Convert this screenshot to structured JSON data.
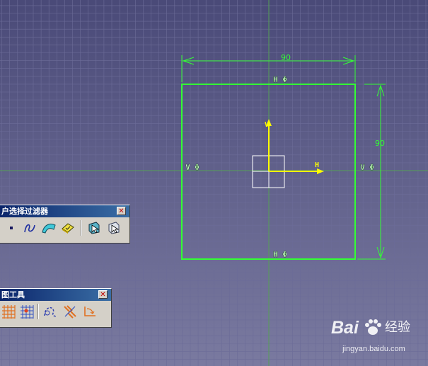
{
  "viewport": {
    "background_top": "#4a4a78",
    "background_bottom": "#7a7aa0",
    "grid_color": "#6c6c98",
    "axis_color": "#55a055"
  },
  "sketch": {
    "square_color": "#33ff33",
    "dim_color": "#33ff33",
    "axis_color": "#ffff00",
    "width_dim": "90",
    "height_dim": "90",
    "h_label": "H",
    "v_label": "V",
    "axis_h_label": "H",
    "axis_v_label": "V",
    "phi_symbol": "Φ",
    "top_constraint": "H Φ",
    "bottom_constraint": "H Φ",
    "left_constraint": "V Φ",
    "right_constraint": "V Φ"
  },
  "toolbar_filter": {
    "title": "户选择过滤器",
    "close_symbol": "✕",
    "buttons": [
      "point-filter-icon",
      "curve-filter-icon",
      "surface-filter-icon",
      "volume-filter-icon",
      "feature-element-filter-icon",
      "geometry-element-filter-icon"
    ]
  },
  "toolbar_sketch": {
    "title": "图工具",
    "close_symbol": "✕",
    "buttons": [
      "grid-icon",
      "snap-to-point-icon",
      "construction-element-icon",
      "geometrical-constraints-icon",
      "dimensional-constraints-icon"
    ]
  },
  "watermark": {
    "brand": "Bai",
    "brand_suffix": "经验",
    "url": "jingyan.baidu.com"
  }
}
